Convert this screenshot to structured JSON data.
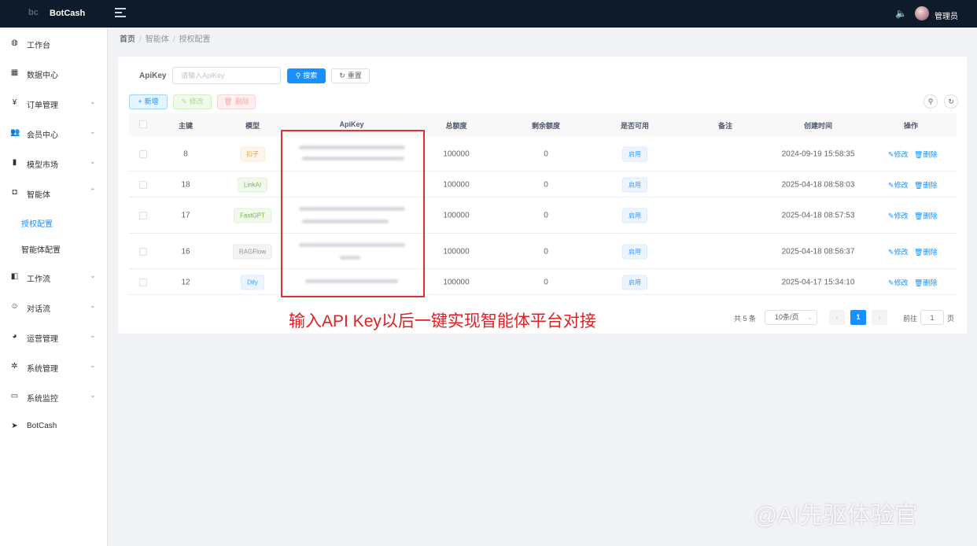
{
  "header": {
    "logo_text": "bc",
    "brand": "BotCash",
    "user_name": "管理员"
  },
  "sidebar": {
    "items": [
      {
        "label": "工作台",
        "icon": "dashboard-icon",
        "glyph": "◍",
        "arrow": ""
      },
      {
        "label": "数据中心",
        "icon": "data-center-icon",
        "glyph": "▦",
        "arrow": ""
      },
      {
        "label": "订单管理",
        "icon": "yen-icon",
        "glyph": "¥",
        "arrow": "⌄"
      },
      {
        "label": "会员中心",
        "icon": "members-icon",
        "glyph": "👥",
        "arrow": "⌄"
      },
      {
        "label": "模型市场",
        "icon": "bar-chart-icon",
        "glyph": "▮",
        "arrow": "⌄"
      },
      {
        "label": "智能体",
        "icon": "agent-icon",
        "glyph": "◘",
        "arrow": "⌃"
      },
      {
        "label": "授权配置",
        "icon": "",
        "glyph": "",
        "arrow": ""
      },
      {
        "label": "智能体配置",
        "icon": "",
        "glyph": "",
        "arrow": ""
      },
      {
        "label": "工作流",
        "icon": "workflow-icon",
        "glyph": "◧",
        "arrow": "⌄"
      },
      {
        "label": "对话流",
        "icon": "dialog-flow-icon",
        "glyph": "☺",
        "arrow": "⌄"
      },
      {
        "label": "运营管理",
        "icon": "globe-icon",
        "glyph": "◕",
        "arrow": "⌄"
      },
      {
        "label": "系统管理",
        "icon": "settings-icon",
        "glyph": "✲",
        "arrow": "⌄"
      },
      {
        "label": "系统监控",
        "icon": "monitor-icon",
        "glyph": "▭",
        "arrow": "⌄"
      },
      {
        "label": "BotCash",
        "icon": "send-icon",
        "glyph": "➤",
        "arrow": ""
      }
    ]
  },
  "breadcrumb": [
    "首页",
    "智能体",
    "授权配置"
  ],
  "search": {
    "label": "ApiKey",
    "placeholder": "请输入ApiKey",
    "search_btn": "搜索",
    "reset_btn": "重置"
  },
  "toolbar": {
    "add": "新增",
    "edit": "修改",
    "delete": "删除"
  },
  "table": {
    "columns": [
      "主键",
      "模型",
      "ApiKey",
      "总额度",
      "剩余额度",
      "是否可用",
      "备注",
      "创建时间",
      "操作"
    ],
    "rows": [
      {
        "id": "8",
        "model": "扣子",
        "model_style": "warn",
        "total": "100000",
        "remaining": "0",
        "status": "启用",
        "remark": "",
        "created": "2024-09-19 15:58:35"
      },
      {
        "id": "18",
        "model": "LinkAI",
        "model_style": "success",
        "total": "100000",
        "remaining": "0",
        "status": "启用",
        "remark": "",
        "created": "2025-04-18 08:58:03"
      },
      {
        "id": "17",
        "model": "FastGPT",
        "model_style": "success",
        "total": "100000",
        "remaining": "0",
        "status": "启用",
        "remark": "",
        "created": "2025-04-18 08:57:53"
      },
      {
        "id": "16",
        "model": "RAGFlow",
        "model_style": "info",
        "total": "100000",
        "remaining": "0",
        "status": "启用",
        "remark": "",
        "created": "2025-04-18 08:56:37"
      },
      {
        "id": "12",
        "model": "Dify",
        "model_style": "primary",
        "total": "100000",
        "remaining": "0",
        "status": "启用",
        "remark": "",
        "created": "2025-04-17 15:34:10"
      }
    ],
    "op_edit": "修改",
    "op_delete": "删除"
  },
  "annotation": "输入API Key以后一键实现智能体平台对接",
  "pagination": {
    "total_text": "共 5 条",
    "page_size": "10条/页",
    "current_page": "1",
    "goto_label": "前往",
    "goto_value": "1",
    "page_unit": "页"
  },
  "watermark": "@AI先驱体验官",
  "colors": {
    "topbar": "#0d1b2a",
    "primary": "#1890ff",
    "highlight": "#e03030"
  }
}
